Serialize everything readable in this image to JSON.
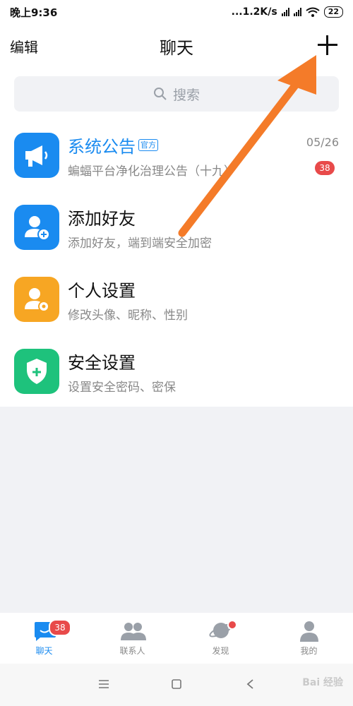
{
  "status": {
    "time": "晚上9:36",
    "network": "...1.2K/s",
    "battery": "22"
  },
  "header": {
    "edit_label": "编辑",
    "title": "聊天"
  },
  "search": {
    "placeholder": "搜索"
  },
  "list": [
    {
      "name": "系统公告",
      "tag": "官方",
      "sub": "蝙蝠平台净化治理公告（十九）",
      "time": "05/26",
      "badge": "38",
      "color": "#1a8bf0"
    },
    {
      "name": "添加好友",
      "sub": "添加好友，端到端安全加密",
      "color": "#1a8bf0"
    },
    {
      "name": "个人设置",
      "sub": "修改头像、昵称、性别",
      "color": "#f7a623"
    },
    {
      "name": "安全设置",
      "sub": "设置安全密码、密保",
      "color": "#1ec27c"
    }
  ],
  "tabs": [
    {
      "label": "聊天",
      "badge": "38"
    },
    {
      "label": "联系人"
    },
    {
      "label": "发现"
    },
    {
      "label": "我的"
    }
  ],
  "watermark": "Bai 经验",
  "colors": {
    "accent": "#1a8bf0",
    "badge": "#e84a4a",
    "arrow": "#f47b29"
  }
}
